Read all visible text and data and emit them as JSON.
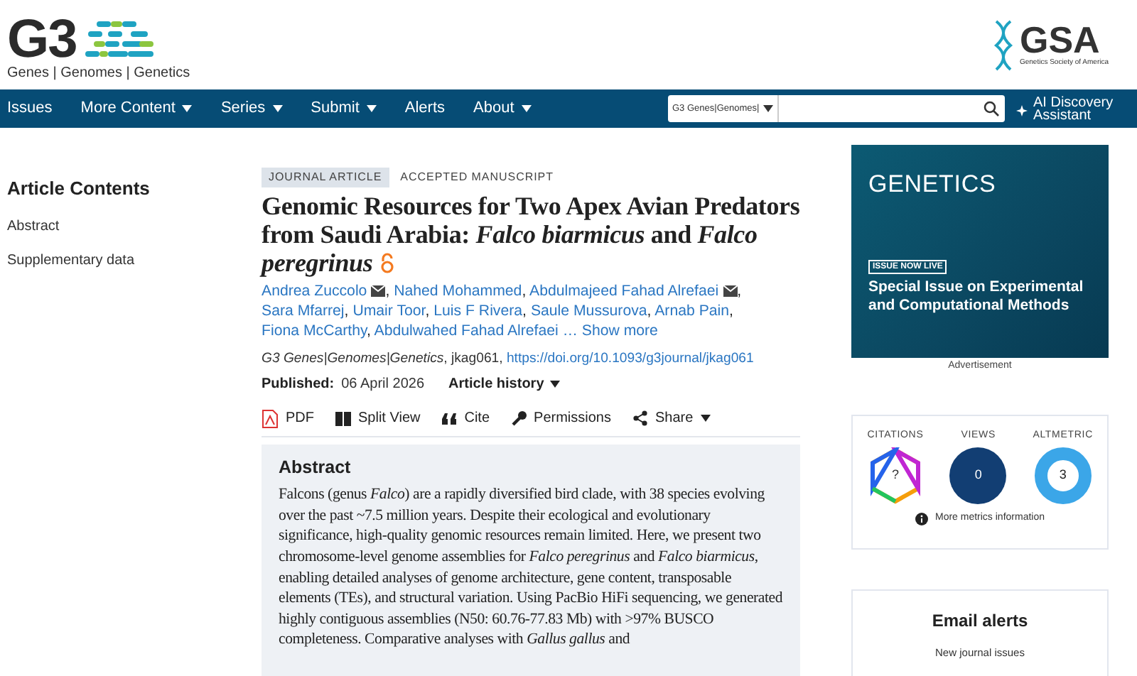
{
  "header": {
    "logo": {
      "mark": "G3",
      "tagline": "Genes | Genomes | Genetics"
    },
    "society_logo": {
      "mark": "GSA",
      "tagline": "Genetics Society of America"
    }
  },
  "nav": {
    "items": [
      {
        "label": "Issues",
        "dropdown": false
      },
      {
        "label": "More Content",
        "dropdown": true
      },
      {
        "label": "Series",
        "dropdown": true
      },
      {
        "label": "Submit",
        "dropdown": true
      },
      {
        "label": "Alerts",
        "dropdown": false
      },
      {
        "label": "About",
        "dropdown": true
      }
    ],
    "search": {
      "scope": "G3 Genes|Genomes|"
    },
    "assistant": "AI Discovery Assistant"
  },
  "sidebar": {
    "title": "Article Contents",
    "items": [
      "Abstract",
      "Supplementary data"
    ]
  },
  "article": {
    "tags": [
      {
        "label": "JOURNAL ARTICLE",
        "kind": "boxed"
      },
      {
        "label": "ACCEPTED MANUSCRIPT",
        "kind": "plain"
      }
    ],
    "title": "Genomic Resources for Two Apex Avian Predators from Saudi Arabia: *Falco biarmicus* and *Falco peregrinus*",
    "open_access": true,
    "authors": [
      {
        "name": "Andrea Zuccolo",
        "email": true
      },
      {
        "name": "Nahed Mohammed",
        "email": false
      },
      {
        "name": "Abdulmajeed Fahad Alrefaei",
        "email": true
      },
      {
        "name": "Sara Mfarrej",
        "email": false
      },
      {
        "name": "Umair Toor",
        "email": false
      },
      {
        "name": "Luis F Rivera",
        "email": false
      },
      {
        "name": "Saule Mussurova",
        "email": false
      },
      {
        "name": "Arnab Pain",
        "email": false
      },
      {
        "name": "Fiona McCarthy",
        "email": false
      },
      {
        "name": "Abdulwahed Fahad Alrefaei",
        "email": false
      }
    ],
    "authors_separator": ",",
    "authors_ellipsis": "…",
    "show_more": "Show more",
    "journal": "G3 Genes|Genomes|Genetics",
    "article_id": ", jkag061, ",
    "doi": "https://doi.org/10.1093/g3journal/jkag061",
    "published_label": "Published:",
    "published_date": "06 April 2026",
    "history": "Article history",
    "tools": [
      {
        "label": "PDF",
        "kind": "pdf"
      },
      {
        "label": "Split View",
        "kind": "split"
      },
      {
        "label": "Cite",
        "kind": "cite"
      },
      {
        "label": "Permissions",
        "kind": "key"
      },
      {
        "label": "Share",
        "kind": "share"
      }
    ],
    "abstract": {
      "heading": "Abstract",
      "text": "Falcons (genus *Falco*) are a rapidly diversified bird clade, with 38 species evolving over the past ~7.5 million years. Despite their ecological and evolutionary significance, high-quality genomic resources remain limited. Here, we present two chromosome-level genome assemblies for *Falco peregrinus* and *Falco biarmicus*, enabling detailed analyses of genome architecture, gene content, transposable elements (TEs), and structural variation. Using PacBio HiFi sequencing, we generated highly contiguous assemblies (N50: 60.76-77.83 Mb) with >97% BUSCO completeness. Comparative analyses with *Gallus gallus* and"
    }
  },
  "ad": {
    "brand": "GENETICS",
    "badge": "ISSUE NOW LIVE",
    "headline": "Special Issue on Experimental and Computational Methods",
    "caption": "Advertisement"
  },
  "metrics": {
    "items": [
      {
        "label": "CITATIONS",
        "value": "?",
        "kind": "hexagon"
      },
      {
        "label": "VIEWS",
        "value": "0",
        "kind": "circle"
      },
      {
        "label": "ALTMETRIC",
        "value": "3",
        "kind": "donut"
      }
    ],
    "more": "More metrics information"
  },
  "email_alerts": {
    "title": "Email alerts",
    "items": [
      "New journal issues"
    ]
  }
}
